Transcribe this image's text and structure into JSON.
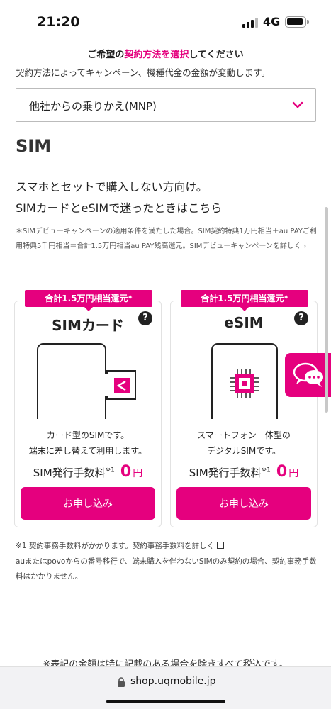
{
  "status_bar": {
    "time": "21:20",
    "network": "4G"
  },
  "header": {
    "title_pre": "ご希望の",
    "title_accent": "契約方法を選択",
    "title_post": "してください",
    "note": "契約方法によってキャンペーン、機種代金の金額が変動します。",
    "select_value": "他社からの乗りかえ(MNP)"
  },
  "section": {
    "heading": "SIM",
    "lead_line1": "スマホとセットで購入しない方向け。",
    "lead_line2_pre": "SIMカードとeSIMで迷ったときは",
    "lead_link": "こちら",
    "campaign_note": "＊SIMデビューキャンペーンの適用条件を満たした場合。SIM契約特典1万円相当＋au PAYご利用特典5千円相当＝合計1.5万円相当au PAY残高還元。SIMデビューキャンペーンを詳しく",
    "campaign_chevron": "›"
  },
  "cards": [
    {
      "badge": "合計1.5万円相当還元*",
      "title": "SIMカード",
      "help": "?",
      "desc1": "カード型のSIMです。",
      "desc2": "端末に差し替えて利用します。",
      "fee_label": "SIM発行手数料",
      "fee_sup": "※1",
      "fee_amount": "0",
      "fee_unit": "円",
      "button": "お申し込み"
    },
    {
      "badge": "合計1.5万円相当還元*",
      "title": "eSIM",
      "help": "?",
      "desc1": "スマートフォン一体型の",
      "desc2": "デジタルSIMです。",
      "fee_label": "SIM発行手数料",
      "fee_sup": "※1",
      "fee_amount": "0",
      "fee_unit": "円",
      "button": "お申し込み"
    }
  ],
  "footnotes": {
    "note1": "※1 契約事務手数料がかかります。契約事務手数料を詳しく",
    "note2": "auまたはpovoからの番号移行で、端末購入を伴わないSIMのみ契約の場合、契約事務手数料はかかりません。",
    "tax": "※表記の金額は特に記載のある場合を除きすべて税込です。"
  },
  "browser": {
    "url": "shop.uqmobile.jp"
  },
  "colors": {
    "accent": "#e5007e"
  },
  "icons": [
    "signal-icon",
    "battery-icon",
    "chevron-down-icon",
    "help-icon",
    "sim-card-illustration",
    "esim-illustration",
    "external-link-icon",
    "chat-icon",
    "lock-icon"
  ]
}
